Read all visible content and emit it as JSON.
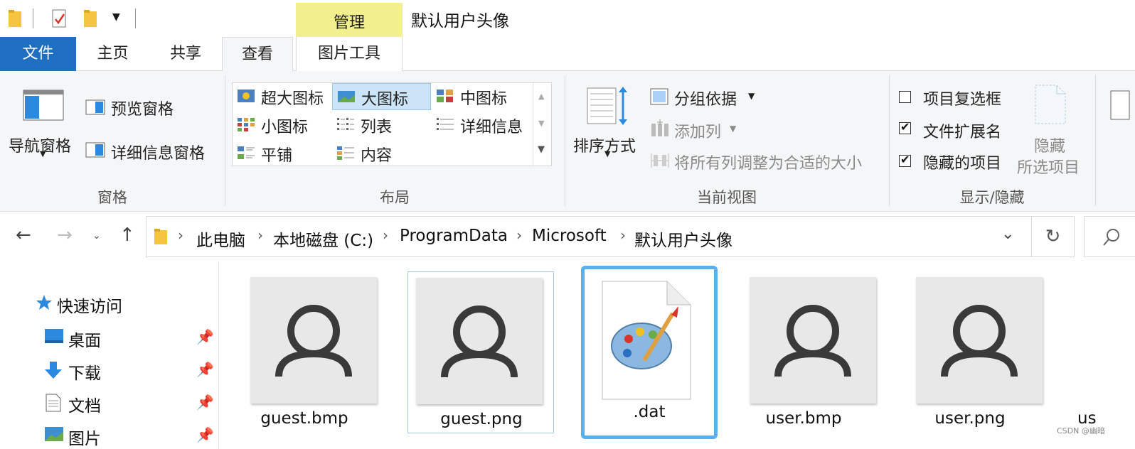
{
  "titlebar": {
    "context_tab": "管理",
    "window_title": "默认用户头像"
  },
  "tabs": [
    {
      "label": "文件"
    },
    {
      "label": "主页"
    },
    {
      "label": "共享"
    },
    {
      "label": "查看"
    },
    {
      "label": "图片工具"
    }
  ],
  "ribbon": {
    "panes": {
      "group_label": "窗格",
      "nav_pane": "导航窗格",
      "preview_pane": "预览窗格",
      "details_pane": "详细信息窗格"
    },
    "layout": {
      "group_label": "布局",
      "items": [
        {
          "label": "超大图标"
        },
        {
          "label": "大图标"
        },
        {
          "label": "中图标"
        },
        {
          "label": "小图标"
        },
        {
          "label": "列表"
        },
        {
          "label": "详细信息"
        },
        {
          "label": "平铺"
        },
        {
          "label": "内容"
        }
      ],
      "selected": "大图标"
    },
    "current_view": {
      "group_label": "当前视图",
      "sort_by": "排序方式",
      "group_by": "分组依据",
      "add_columns": "添加列",
      "size_all_columns": "将所有列调整为合适的大小"
    },
    "show_hide": {
      "group_label": "显示/隐藏",
      "item_checkboxes": {
        "label": "项目复选框",
        "checked": false
      },
      "file_extensions": {
        "label": "文件扩展名",
        "checked": true
      },
      "hidden_items": {
        "label": "隐藏的项目",
        "checked": true
      },
      "hide_selected_line1": "隐藏",
      "hide_selected_line2": "所选项目"
    }
  },
  "address": {
    "crumbs": [
      "此电脑",
      "本地磁盘 (C:)",
      "ProgramData",
      "Microsoft",
      "默认用户头像"
    ]
  },
  "navpane": {
    "quick_access": "快速访问",
    "items": [
      {
        "label": "桌面"
      },
      {
        "label": "下载"
      },
      {
        "label": "文档"
      },
      {
        "label": "图片"
      }
    ]
  },
  "files": [
    {
      "name": "guest.bmp",
      "icon": "user-avatar-icon"
    },
    {
      "name": "guest.png",
      "icon": "user-avatar-icon"
    },
    {
      "name": ".dat",
      "icon": "paint-palette-icon"
    },
    {
      "name": "user.bmp",
      "icon": "user-avatar-icon"
    },
    {
      "name": "user.png",
      "icon": "user-avatar-icon"
    },
    {
      "name": "us",
      "icon": "user-avatar-icon"
    }
  ],
  "watermark": "CSDN @幽暗",
  "colors": {
    "file_tab": "#1e6fc1",
    "context_tab": "#f2ef8e",
    "selection": "#cce4f7",
    "focus_border": "#58b0ef"
  }
}
